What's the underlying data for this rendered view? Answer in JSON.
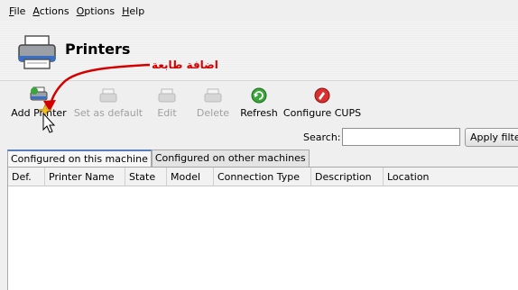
{
  "menubar": {
    "items": [
      {
        "u": "F",
        "rest": "ile"
      },
      {
        "u": "A",
        "rest": "ctions"
      },
      {
        "u": "O",
        "rest": "ptions"
      },
      {
        "u": "H",
        "rest": "elp"
      }
    ]
  },
  "header": {
    "title": "Printers",
    "annotation": "اضافة طابعة"
  },
  "toolbar": {
    "add_printer": "Add Printer",
    "set_default": "Set as default",
    "edit": "Edit",
    "delete": "Delete",
    "refresh": "Refresh",
    "configure_cups": "Configure CUPS"
  },
  "search": {
    "label": "Search:",
    "value": "",
    "apply_label": "Apply filter"
  },
  "tabs": {
    "local": "Configured on this machine",
    "other": "Configured on other machines"
  },
  "table": {
    "columns": [
      "Def.",
      "Printer Name",
      "State",
      "Model",
      "Connection Type",
      "Description",
      "Location"
    ]
  },
  "colors": {
    "annotation": "#d40000",
    "refresh_icon": "#3aa53a",
    "cups_icon": "#d93030"
  }
}
